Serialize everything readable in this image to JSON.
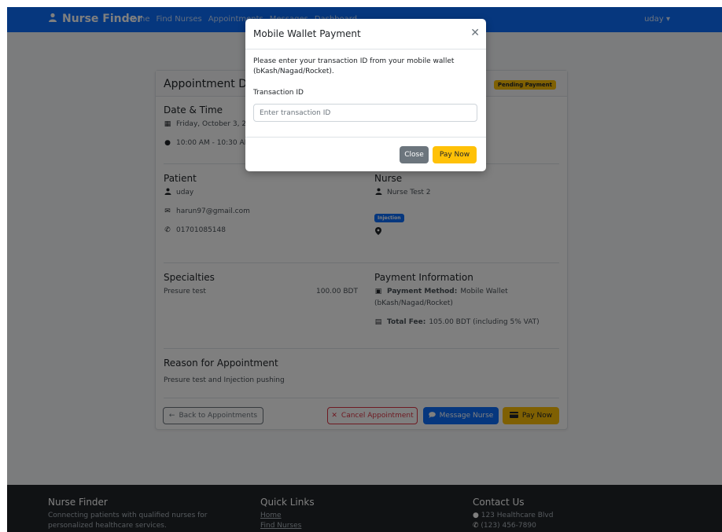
{
  "navbar": {
    "brand": "Nurse Finder",
    "links": [
      "Home",
      "Find Nurses",
      "Appointments",
      "Messages",
      "Dashboard"
    ],
    "user": "uday ▾"
  },
  "card": {
    "title": "Appointment Details",
    "status_badge": "Pending Payment",
    "datetime": {
      "heading": "Date & Time",
      "date": "Friday, October 3, 2025",
      "time": "10:00 AM - 10:30 AM"
    },
    "patient": {
      "heading": "Patient",
      "name": "uday",
      "email": "harun97@gmail.com",
      "phone": "01701085148"
    },
    "nurse": {
      "heading": "Nurse",
      "name": "Nurse Test 2",
      "specialty_badge": "Injection"
    },
    "specialties": {
      "heading": "Specialties",
      "item_name": "Presure test",
      "item_price": "100.00 BDT"
    },
    "payment": {
      "heading": "Payment Information",
      "method_label": "Payment Method:",
      "method_value": "Mobile Wallet",
      "method_value_line2": "(bKash/Nagad/Rocket)",
      "fee_label": "Total Fee:",
      "fee_value": "105.00 BDT (including 5% VAT)"
    },
    "reason": {
      "heading": "Reason for Appointment",
      "text": "Presure test and Injection pushing"
    },
    "buttons": {
      "back": "Back to Appointments",
      "cancel": "Cancel Appointment",
      "message": "Message Nurse",
      "pay": "Pay Now"
    }
  },
  "footer": {
    "col1_title": "Nurse Finder",
    "col1_text1": "Connecting patients with qualified nurses for",
    "col1_text2": "personalized healthcare services.",
    "col2_title": "Quick Links",
    "col2_link1": "Home",
    "col2_link2": "Find Nurses",
    "col3_title": "Contact Us",
    "col3_address": "123 Healthcare Blvd",
    "col3_phone": "(123) 456-7890"
  },
  "modal": {
    "title": "Mobile Wallet Payment",
    "description": "Please enter your transaction ID from your mobile wallet (bKash/Nagad/Rocket).",
    "field_label": "Transaction ID",
    "field_placeholder": "Enter transaction ID",
    "close_button": "Close",
    "pay_button": "Pay Now"
  },
  "colors": {
    "primary": "#0d6efd",
    "warning": "#ffc107",
    "danger": "#dc3545",
    "secondary": "#6c757d",
    "footer_bg": "#212529"
  },
  "icons": [
    "user-nurse-icon",
    "calendar-icon",
    "clock-icon",
    "user-icon",
    "envelope-icon",
    "phone-icon",
    "map-marker-icon",
    "money-icon",
    "calculator-icon",
    "arrow-left-icon",
    "times-icon",
    "comment-icon",
    "credit-card-icon",
    "close-icon"
  ]
}
